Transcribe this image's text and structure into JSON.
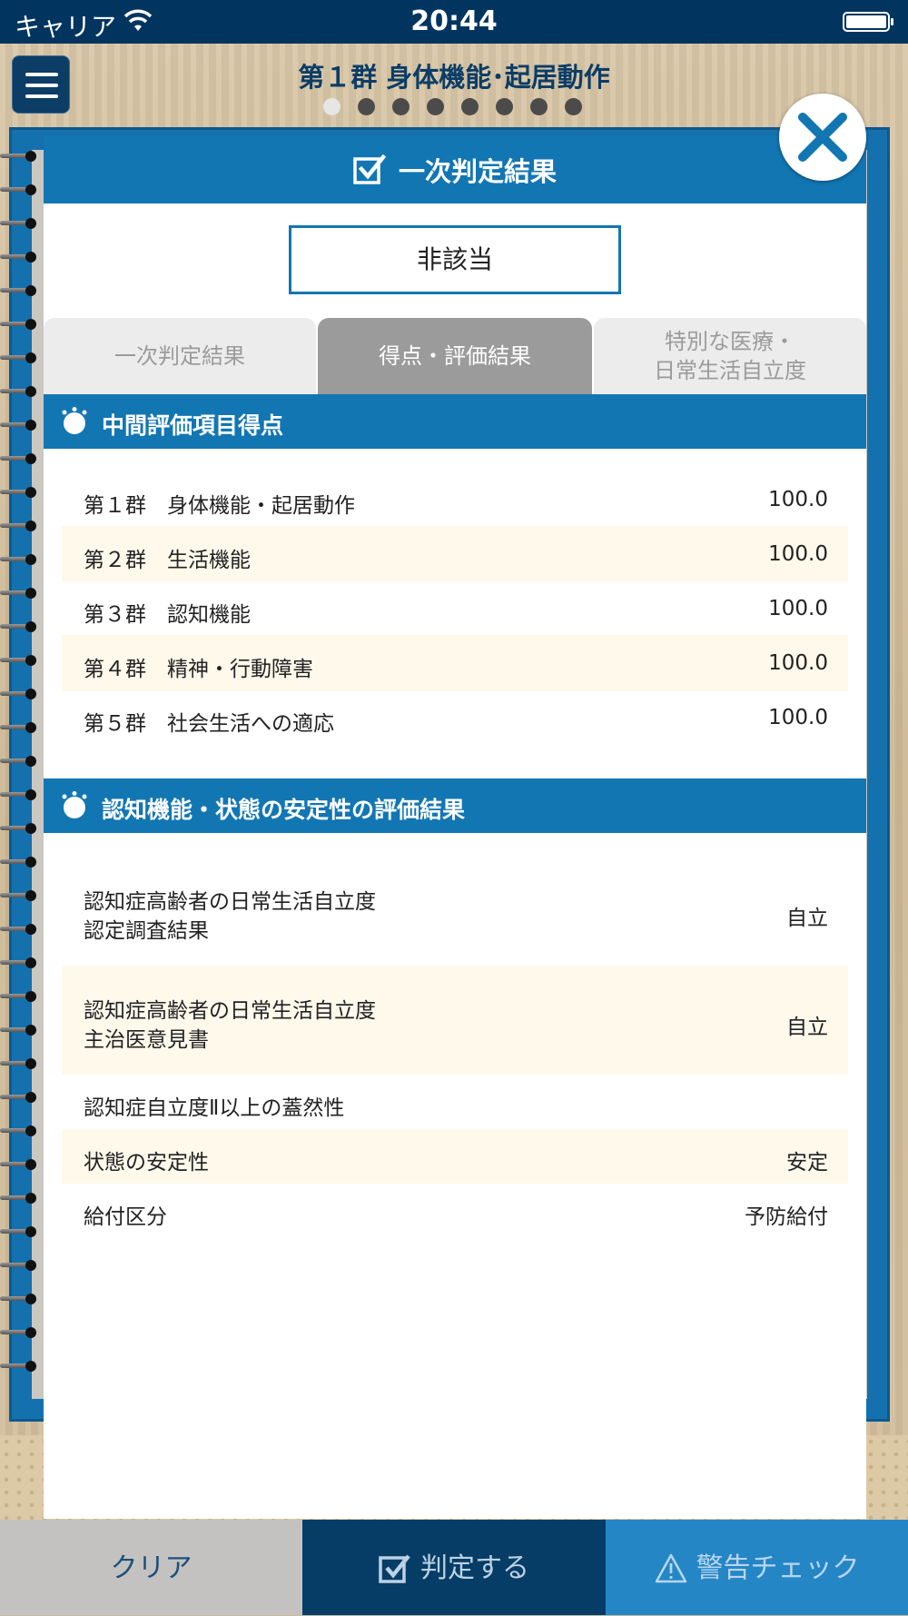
{
  "status_bar": {
    "carrier": "キャリア",
    "time": "20:44"
  },
  "header": {
    "title": "第１群 身体機能･起居動作",
    "page_count": 8,
    "active_page": 1
  },
  "modal": {
    "title": "一次判定結果",
    "result": "非該当",
    "tabs": [
      {
        "label": "一次判定結果",
        "active": false
      },
      {
        "label": "得点・評価結果",
        "active": true
      },
      {
        "label": "特別な医療・\n日常生活自立度",
        "active": false
      }
    ],
    "section1": {
      "title": "中間評価項目得点",
      "rows": [
        {
          "label": "第１群　身体機能・起居動作",
          "value": "100.0"
        },
        {
          "label": "第２群　生活機能",
          "value": "100.0"
        },
        {
          "label": "第３群　認知機能",
          "value": "100.0"
        },
        {
          "label": "第４群　精神・行動障害",
          "value": "100.0"
        },
        {
          "label": "第５群　社会生活への適応",
          "value": "100.0"
        }
      ]
    },
    "section2": {
      "title": "認知機能・状態の安定性の評価結果",
      "rows": [
        {
          "label": "認知症高齢者の日常生活自立度\n認定調査結果",
          "value": "自立"
        },
        {
          "label": "認知症高齢者の日常生活自立度\n主治医意見書",
          "value": "自立"
        },
        {
          "label": "認知症自立度Ⅱ以上の蓋然性",
          "value": ""
        },
        {
          "label": "状態の安定性",
          "value": "安定"
        },
        {
          "label": "給付区分",
          "value": "予防給付"
        }
      ]
    }
  },
  "bottom_bar": {
    "clear_label": "クリア",
    "judge_label": "判定する",
    "warn_label": "警告チェック"
  },
  "colors": {
    "primary_blue": "#1276b3",
    "navy": "#013560",
    "row_alt": "#fff9ec"
  }
}
